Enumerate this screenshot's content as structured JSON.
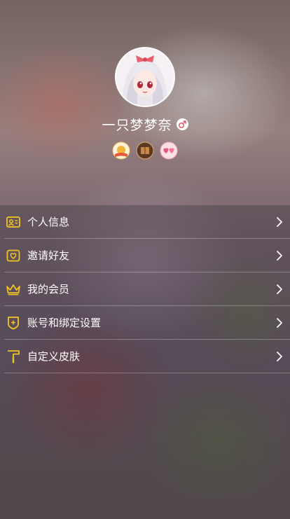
{
  "profile": {
    "username": "一只梦梦奈",
    "gender": "male"
  },
  "badges": [
    {
      "icon": "sun-badge-icon",
      "color": "#e9a63a"
    },
    {
      "icon": "book-badge-icon",
      "color": "#7a4a2b"
    },
    {
      "icon": "hearts-badge-icon",
      "color": "#e4587a"
    }
  ],
  "menu": {
    "items": [
      {
        "label": "个人信息",
        "icon": "id-card-icon"
      },
      {
        "label": "邀请好友",
        "icon": "invite-heart-icon"
      },
      {
        "label": "我的会员",
        "icon": "crown-icon"
      },
      {
        "label": "账号和绑定设置",
        "icon": "shield-plus-icon"
      },
      {
        "label": "自定义皮肤",
        "icon": "paint-roller-icon"
      }
    ]
  },
  "colors": {
    "accent": "#f3c321",
    "text": "#ffffff"
  }
}
